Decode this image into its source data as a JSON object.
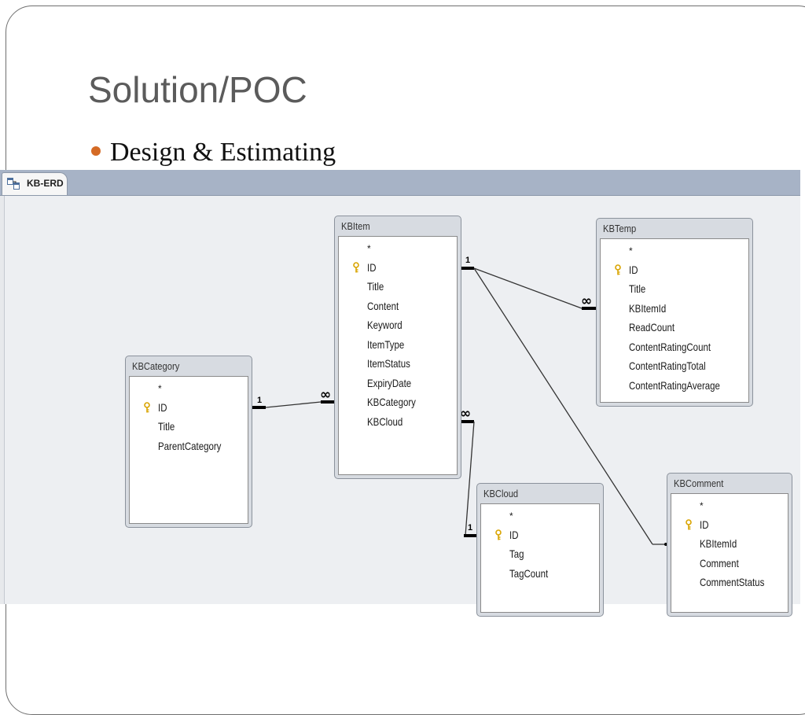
{
  "slide": {
    "title": "Solution/POC",
    "bullet": "Design & Estimating"
  },
  "erd": {
    "tab": {
      "label": "KB-ERD",
      "icon": "relationships-icon"
    },
    "tables": {
      "kbitem": {
        "name": "KBItem",
        "fields": [
          "*",
          "ID",
          "Title",
          "Content",
          "Keyword",
          "ItemType",
          "ItemStatus",
          "ExpiryDate",
          "KBCategory",
          "KBCloud"
        ]
      },
      "kbtemp": {
        "name": "KBTemp",
        "fields": [
          "*",
          "ID",
          "Title",
          "KBItemId",
          "ReadCount",
          "ContentRatingCount",
          "ContentRatingTotal",
          "ContentRatingAverage"
        ]
      },
      "kbcategory": {
        "name": "KBCategory",
        "fields": [
          "*",
          "ID",
          "Title",
          "ParentCategory"
        ]
      },
      "kbcloud": {
        "name": "KBCloud",
        "fields": [
          "*",
          "ID",
          "Tag",
          "TagCount"
        ]
      },
      "kbcomment": {
        "name": "KBComment",
        "fields": [
          "*",
          "ID",
          "KBItemId",
          "Comment",
          "CommentStatus"
        ]
      }
    },
    "key_icon": "primary-key-icon",
    "relationships": [
      {
        "name": "kbitem-kbtemp",
        "one": "1",
        "many": "∞"
      },
      {
        "name": "kbcategory-kbitem",
        "one": "1",
        "many": "∞"
      },
      {
        "name": "kbitem-kbcloud",
        "one": "1",
        "many": "∞"
      },
      {
        "name": "kbitem-kbcomment"
      }
    ],
    "colors": {
      "tab_strip": "#a7b3c6",
      "canvas": "#edeff2",
      "table_header": "#d7dbe1",
      "bullet": "#d46a25",
      "key": "#d9a400"
    }
  }
}
